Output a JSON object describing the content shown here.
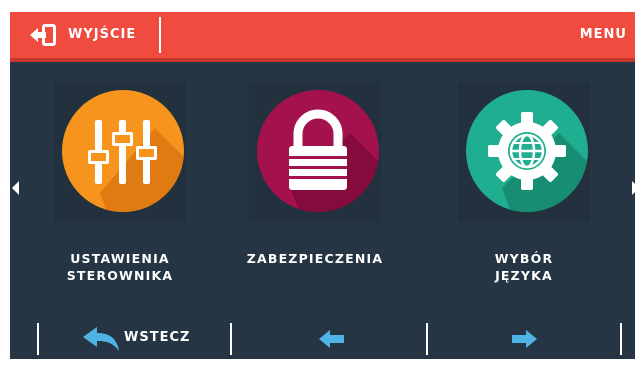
{
  "header": {
    "exit_label": "WYJŚCIE",
    "menu_label": "MENU",
    "exit_icon": "exit-door-icon"
  },
  "tiles": [
    {
      "label_line1": "USTAWIENIA",
      "label_line2": "STEROWNIKA",
      "icon": "sliders-icon",
      "color": "#f7941d"
    },
    {
      "label_line1": "ZABEZPIECZENIA",
      "label_line2": "",
      "icon": "lock-icon",
      "color": "#a4124d"
    },
    {
      "label_line1": "WYBÓR",
      "label_line2": "JĘZYKA",
      "icon": "globe-gear-icon",
      "color": "#1fae8f"
    }
  ],
  "footer": {
    "back_label": "WSTECZ",
    "back_icon": "back-arrow-icon",
    "prev_icon": "arrow-left-icon",
    "next_icon": "arrow-right-icon"
  },
  "colors": {
    "header_bg": "#ef4b3f",
    "screen_bg": "#263543",
    "accent_blue": "#4fb3e6"
  }
}
